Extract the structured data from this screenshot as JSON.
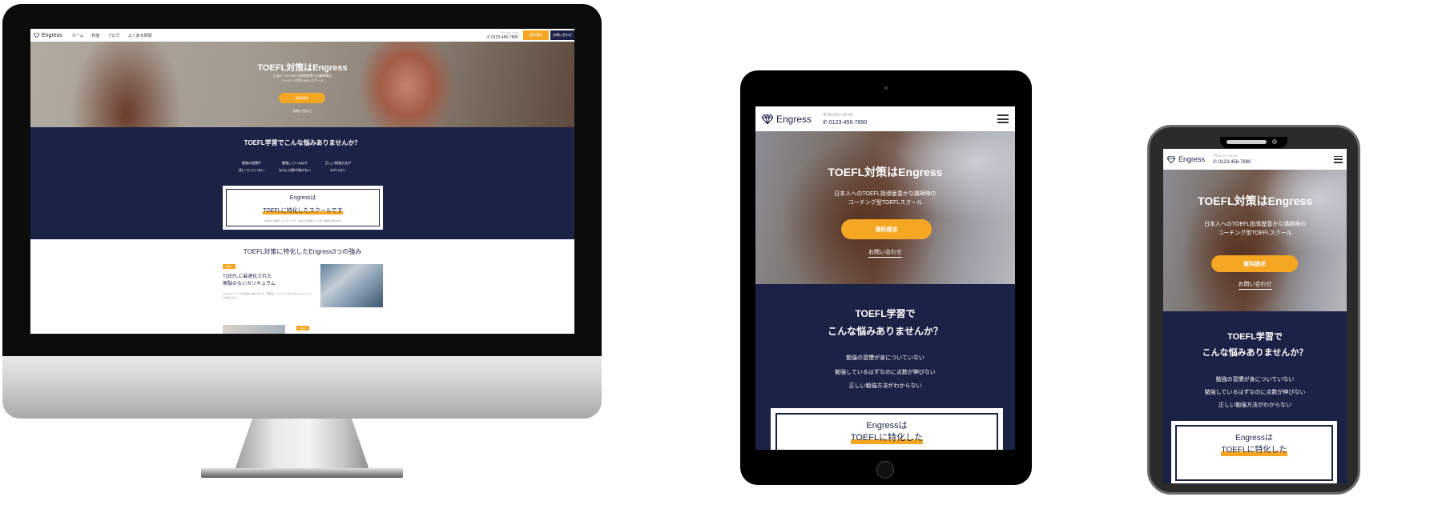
{
  "desktop": {
    "logo": "Engress",
    "nav_items": [
      "ホーム",
      "料金",
      "ブログ",
      "よくある質問"
    ],
    "tel_hours": "平日 9:00〜21:00",
    "tel": "0123-456-7890",
    "btn_request": "資料請求",
    "btn_contact": "お問い合わせ",
    "hero_title": "TOEFL対策はEngress",
    "hero_sub_1": "日本人へのTOEFL指導歴豊かな講師陣の",
    "hero_sub_2": "コーチング型TOEFLスクール",
    "hero_cta": "資料請求",
    "hero_link": "お問い合わせ",
    "worry_title": "TOEFL学習でこんな悩みありませんか？",
    "worries": [
      {
        "l1": "勉強の習慣が",
        "l2": "身についていない"
      },
      {
        "l1": "勉強しているはず",
        "l2": "なのに点数が伸びない"
      },
      {
        "l1": "正しい勉強方法が",
        "l2": "わからない"
      }
    ],
    "box_t1": "Engressは",
    "box_t2": "TOEFLに特化したスクールです",
    "box_t3_1": "TOEFLに特化したスクールで、あなたの目標スコアまで最短で導きます",
    "box_t3_2": "",
    "strength_title": "TOEFL対策に特化したEngress3つの強み",
    "tag1": "強み1",
    "tag2": "強み2",
    "feature_title_1": "TOEFLに最適化された",
    "feature_title_2": "無駄のないカリキュラム",
    "feature_text": "TOEFLのスコアを効率的に伸ばすため、受験者一人ひとりに合わせたカリキュラムを作成します。"
  },
  "tablet": {
    "logo": "Engress",
    "tel_hours": "平日9:00〜20:00",
    "tel": "0123-456-7890",
    "hero_title": "TOEFL対策はEngress",
    "hero_sub_1": "日本人へのTOEFL指導歴豊かな講師陣の",
    "hero_sub_2": "コーチング型TOEFLスクール",
    "hero_cta": "資料請求",
    "hero_link": "お問い合わせ",
    "worry_title_1": "TOEFL学習で",
    "worry_title_2": "こんな悩みありませんか？",
    "worries": [
      "勉強の習慣が身についていない",
      "勉強しているはずなのに点数が伸びない",
      "正しい勉強方法がわからない"
    ],
    "box_t1": "Engressは",
    "box_t2": "TOEFLに特化した"
  },
  "phone": {
    "logo": "Engress",
    "tel_hours": "平日9:00〜20:00",
    "tel": "0123-456-7890",
    "hero_title": "TOEFL対策はEngress",
    "hero_sub_1": "日本人へのTOEFL指導歴豊かな講師陣の",
    "hero_sub_2": "コーチング型TOEFLスクール",
    "hero_cta": "資料請求",
    "hero_link": "お問い合わせ",
    "worry_title_1": "TOEFL学習で",
    "worry_title_2": "こんな悩みありませんか？",
    "worries": [
      "勉強の習慣が身についていない",
      "勉強しているはずなのに点数が伸びない",
      "正しい勉強方法がわからない"
    ],
    "box_t1": "Engressは",
    "box_t2": "TOEFLに特化した"
  },
  "colors": {
    "navy": "#1c2146",
    "accent": "#f5a623"
  }
}
